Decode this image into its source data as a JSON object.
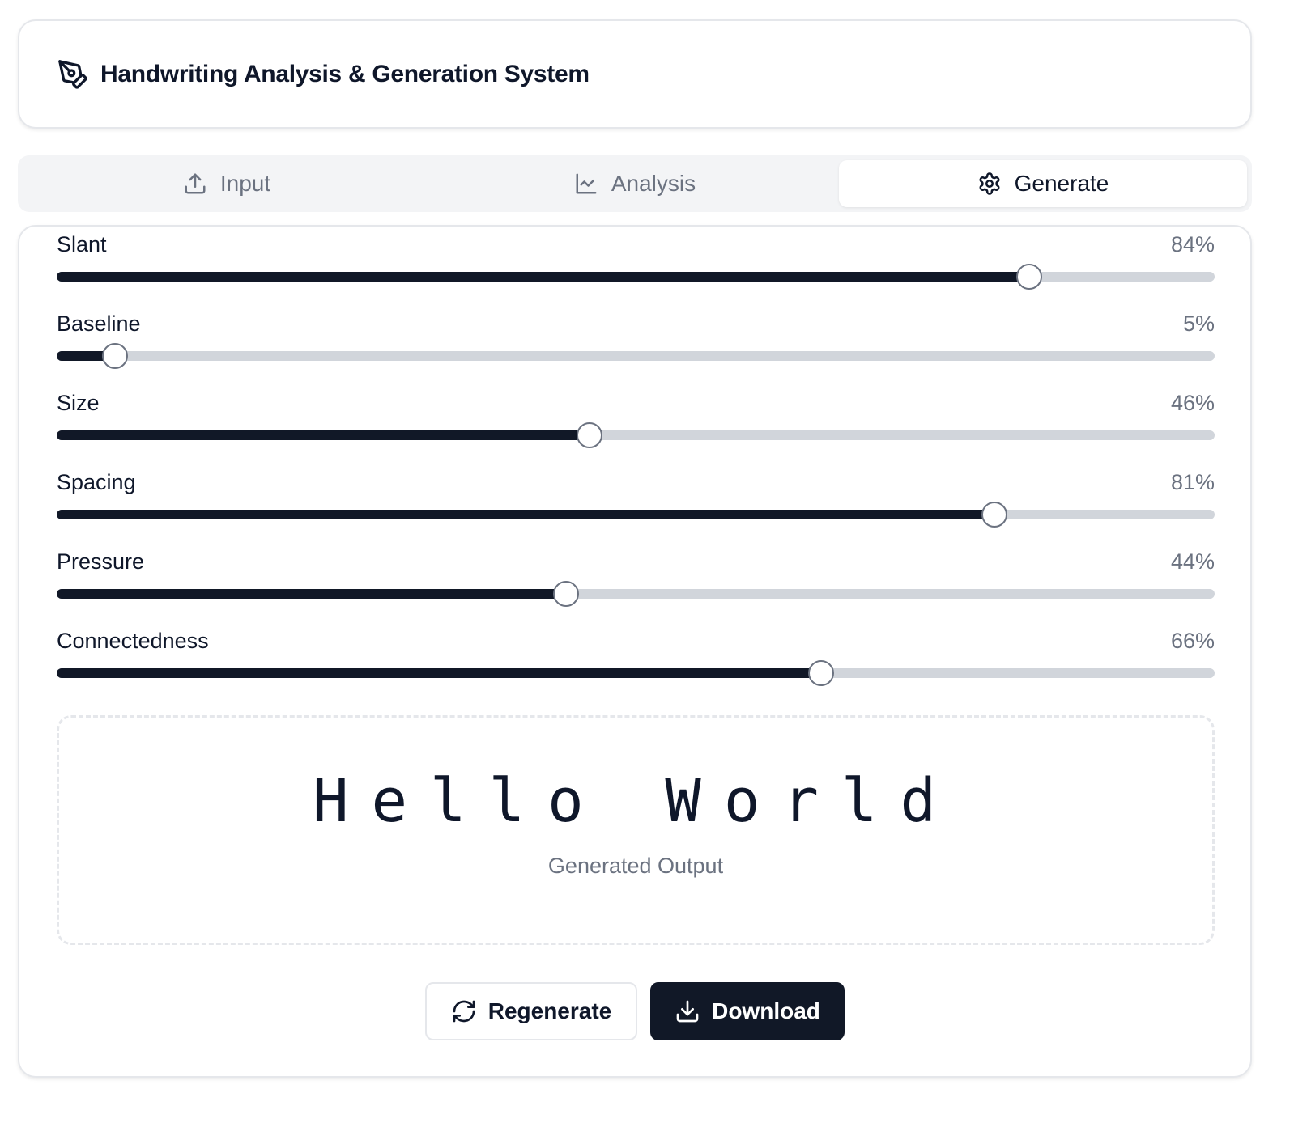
{
  "header": {
    "title": "Handwriting Analysis & Generation System",
    "icon": "pen-tool-icon"
  },
  "tabs": [
    {
      "label": "Input",
      "icon": "upload-icon",
      "active": false
    },
    {
      "label": "Analysis",
      "icon": "line-chart-icon",
      "active": false
    },
    {
      "label": "Generate",
      "icon": "gear-icon",
      "active": true
    }
  ],
  "sliders": [
    {
      "label": "Slant",
      "value_text": "84%",
      "value": 84
    },
    {
      "label": "Baseline",
      "value_text": "5%",
      "value": 5
    },
    {
      "label": "Size",
      "value_text": "46%",
      "value": 46
    },
    {
      "label": "Spacing",
      "value_text": "81%",
      "value": 81
    },
    {
      "label": "Pressure",
      "value_text": "44%",
      "value": 44
    },
    {
      "label": "Connectedness",
      "value_text": "66%",
      "value": 66
    }
  ],
  "output": {
    "text": "Hello World",
    "caption": "Generated Output"
  },
  "buttons": {
    "regenerate": {
      "label": "Regenerate",
      "icon": "refresh-icon"
    },
    "download": {
      "label": "Download",
      "icon": "download-icon"
    }
  },
  "colors": {
    "accent": "#111827",
    "track": "#d1d5db",
    "muted": "#6b7280"
  }
}
